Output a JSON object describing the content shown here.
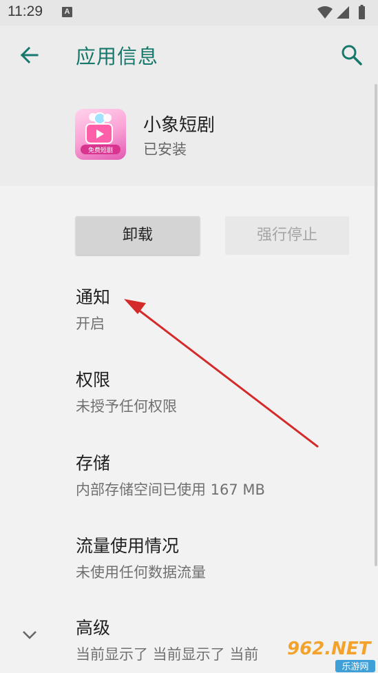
{
  "status_bar": {
    "time": "11:29",
    "notification_icon": "A"
  },
  "app_bar": {
    "title": "应用信息",
    "back_icon": "arrow-left-icon",
    "search_icon": "search-icon"
  },
  "app": {
    "name": "小象短剧",
    "status": "已安装",
    "icon_text": "免费短剧"
  },
  "buttons": {
    "uninstall": "卸载",
    "force_stop": "强行停止"
  },
  "items": [
    {
      "title": "通知",
      "subtitle": "开启"
    },
    {
      "title": "权限",
      "subtitle": "未授予任何权限"
    },
    {
      "title": "存储",
      "subtitle": "内部存储空间已使用 167 MB"
    },
    {
      "title": "流量使用情况",
      "subtitle": "未使用任何数据流量"
    },
    {
      "title": "高级",
      "subtitle": "当前显示了 当前显示了 当前"
    }
  ],
  "watermark": {
    "text": "962.NET",
    "sub": "乐游网"
  },
  "colors": {
    "accent": "#16776b",
    "arrow": "#d42a2a"
  }
}
